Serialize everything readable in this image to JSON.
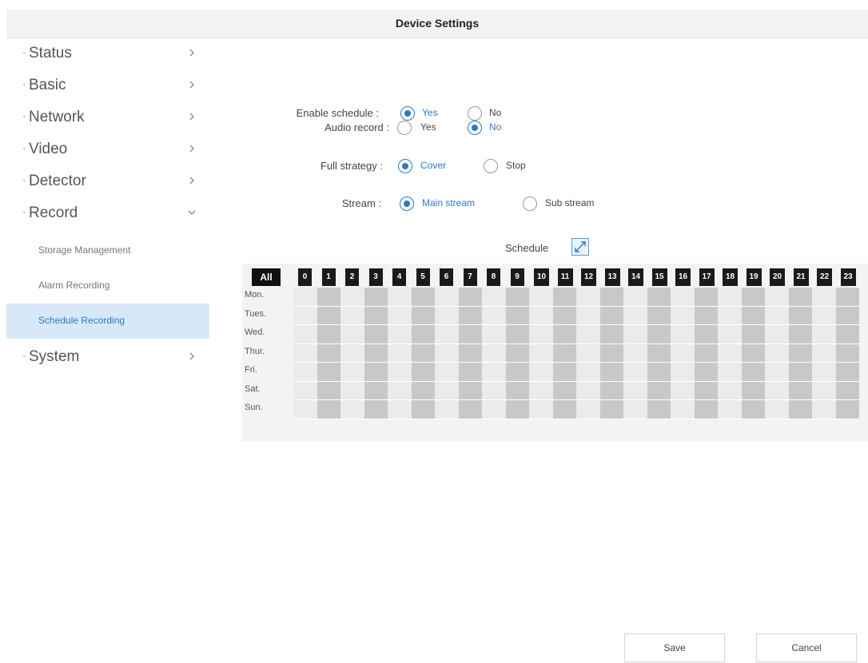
{
  "header": {
    "title": "Device Settings"
  },
  "sidebar": {
    "items": [
      {
        "label": "Status",
        "expanded": false
      },
      {
        "label": "Basic",
        "expanded": false
      },
      {
        "label": "Network",
        "expanded": false
      },
      {
        "label": "Video",
        "expanded": false
      },
      {
        "label": "Detector",
        "expanded": false
      },
      {
        "label": "Record",
        "expanded": true
      },
      {
        "label": "System",
        "expanded": false
      }
    ],
    "record_subitems": [
      {
        "label": "Storage Management"
      },
      {
        "label": "Alarm Recording"
      },
      {
        "label": "Schedule Recording",
        "active": true
      }
    ]
  },
  "form": {
    "enable_schedule": {
      "label": "Enable schedule :",
      "options": [
        "Yes",
        "No"
      ],
      "selected": "Yes"
    },
    "audio_record": {
      "label": "Audio record :",
      "options": [
        "Yes",
        "No"
      ],
      "selected": "No"
    },
    "full_strategy": {
      "label": "Full strategy :",
      "options": [
        "Cover",
        "Stop"
      ],
      "selected": "Cover"
    },
    "stream": {
      "label": "Stream :",
      "options": [
        "Main stream",
        "Sub stream"
      ],
      "selected": "Main stream"
    }
  },
  "schedule": {
    "title": "Schedule",
    "all_label": "All",
    "hours": [
      "0",
      "1",
      "2",
      "3",
      "4",
      "5",
      "6",
      "7",
      "8",
      "9",
      "10",
      "11",
      "12",
      "13",
      "14",
      "15",
      "16",
      "17",
      "18",
      "19",
      "20",
      "21",
      "22",
      "23"
    ],
    "days": [
      "Mon.",
      "Tues.",
      "Wed.",
      "Thur.",
      "Fri.",
      "Sat.",
      "Sun."
    ]
  },
  "actions": {
    "save": "Save",
    "cancel": "Cancel"
  },
  "colors": {
    "accent": "#2d78c8",
    "active_bg": "#d7e9f8",
    "slot_dark": "#c8c8c8",
    "slot_light": "#ebebeb"
  },
  "icons": {
    "nav_arrow": "chevron-right-icon",
    "nav_expanded": "chevron-down-icon",
    "schedule_expand": "expand-icon"
  }
}
